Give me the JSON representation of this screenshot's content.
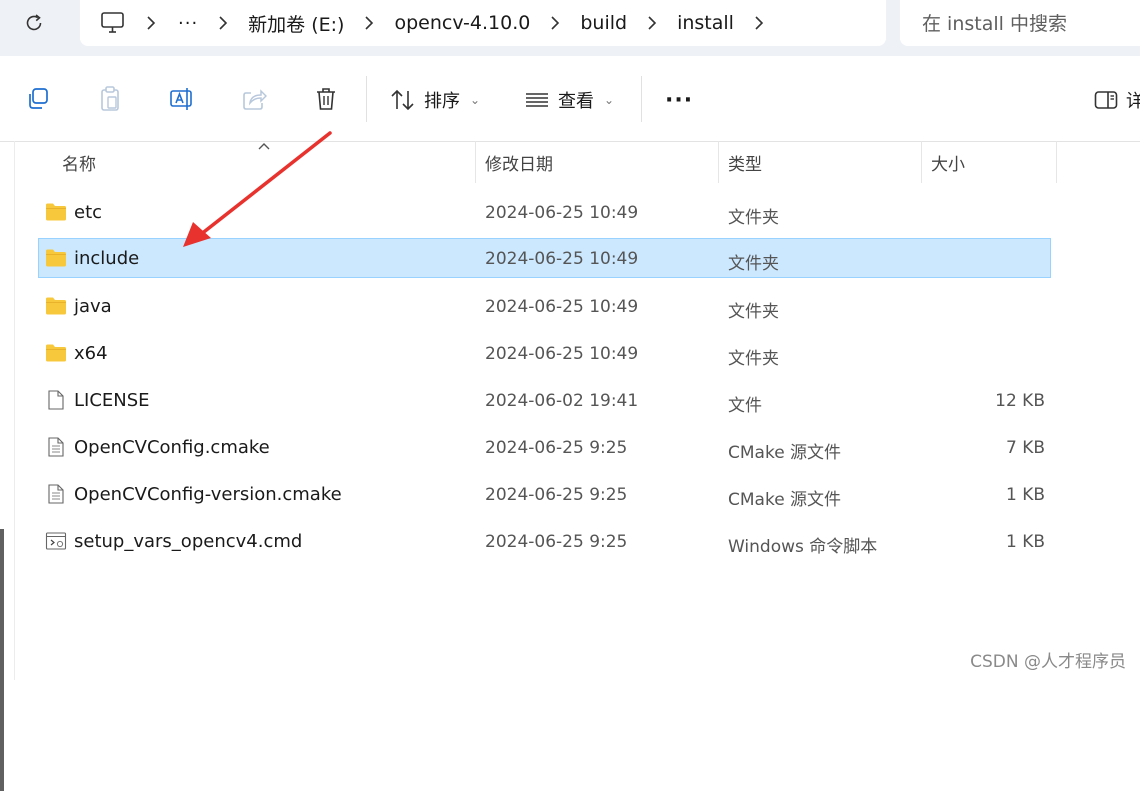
{
  "breadcrumb": {
    "more": "···",
    "items": [
      "新加卷 (E:)",
      "opencv-4.10.0",
      "build",
      "install"
    ]
  },
  "search": {
    "placeholder": "在 install 中搜索"
  },
  "toolbar": {
    "sort_label": "排序",
    "view_label": "查看",
    "more_label": "···",
    "details_label": "详"
  },
  "columns": {
    "name": "名称",
    "date": "修改日期",
    "type": "类型",
    "size": "大小"
  },
  "files": [
    {
      "name": "etc",
      "date": "2024-06-25 10:49",
      "type": "文件夹",
      "size": "",
      "icon": "folder-icon"
    },
    {
      "name": "include",
      "date": "2024-06-25 10:49",
      "type": "文件夹",
      "size": "",
      "icon": "folder-icon",
      "selected": true
    },
    {
      "name": "java",
      "date": "2024-06-25 10:49",
      "type": "文件夹",
      "size": "",
      "icon": "folder-icon"
    },
    {
      "name": "x64",
      "date": "2024-06-25 10:49",
      "type": "文件夹",
      "size": "",
      "icon": "folder-icon"
    },
    {
      "name": "LICENSE",
      "date": "2024-06-02 19:41",
      "type": "文件",
      "size": "12 KB",
      "icon": "file-icon"
    },
    {
      "name": "OpenCVConfig.cmake",
      "date": "2024-06-25 9:25",
      "type": "CMake 源文件",
      "size": "7 KB",
      "icon": "text-file-icon"
    },
    {
      "name": "OpenCVConfig-version.cmake",
      "date": "2024-06-25 9:25",
      "type": "CMake 源文件",
      "size": "1 KB",
      "icon": "text-file-icon"
    },
    {
      "name": "setup_vars_opencv4.cmd",
      "date": "2024-06-25 9:25",
      "type": "Windows 命令脚本",
      "size": "1 KB",
      "icon": "script-file-icon"
    }
  ],
  "colors": {
    "selection_bg": "#cce8ff",
    "selection_border": "#99d1ff",
    "folder": "#f8c83c",
    "annotation_arrow": "#e8322e"
  },
  "watermark": "CSDN @人才程序员"
}
